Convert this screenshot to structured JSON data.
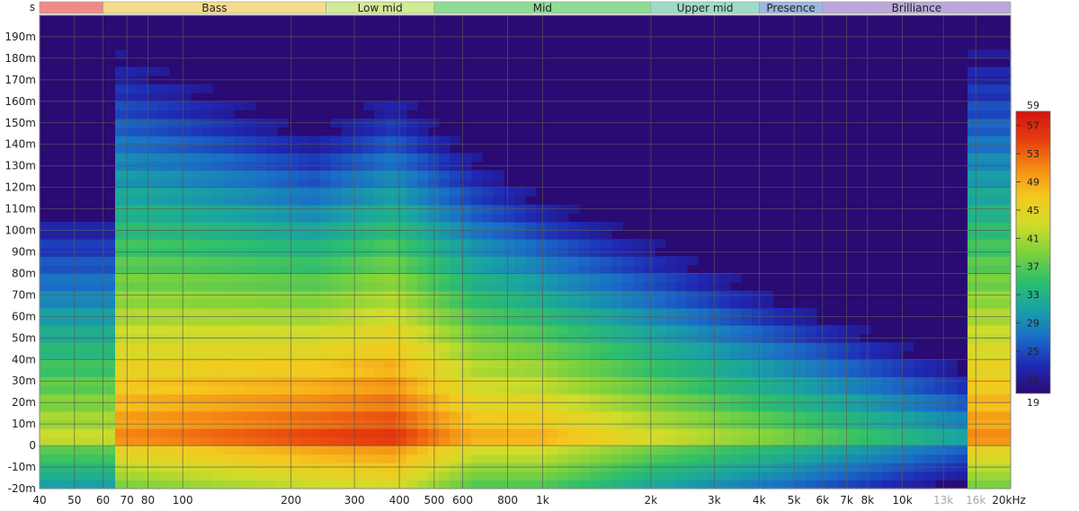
{
  "chart_data": {
    "type": "heatmap",
    "title": "",
    "ylabel": "s",
    "x_axis_unit": "kHz",
    "x_scale": "log",
    "xlim": [
      40,
      20000
    ],
    "ylim": [
      -0.02,
      0.2
    ],
    "x_tick_labels": [
      "40",
      "50",
      "60",
      "70",
      "80",
      "100",
      "200",
      "300",
      "400",
      "500",
      "600",
      "800",
      "1k",
      "2k",
      "3k",
      "4k",
      "5k",
      "6k",
      "7k",
      "8k",
      "10k",
      "13k",
      "16k",
      "20kHz"
    ],
    "x_tick_values": [
      40,
      50,
      60,
      70,
      80,
      100,
      200,
      300,
      400,
      500,
      600,
      800,
      1000,
      2000,
      3000,
      4000,
      5000,
      6000,
      7000,
      8000,
      10000,
      13000,
      16000,
      20000
    ],
    "x_tick_muted": [
      false,
      false,
      false,
      false,
      false,
      false,
      false,
      false,
      false,
      false,
      false,
      false,
      false,
      false,
      false,
      false,
      false,
      false,
      false,
      false,
      false,
      true,
      true,
      false
    ],
    "y_tick_labels": [
      "-20m",
      "-10m",
      "0",
      "10m",
      "20m",
      "30m",
      "40m",
      "50m",
      "60m",
      "70m",
      "80m",
      "90m",
      "100m",
      "110m",
      "120m",
      "130m",
      "140m",
      "150m",
      "160m",
      "170m",
      "180m",
      "190m"
    ],
    "y_tick_values": [
      -0.02,
      -0.01,
      0,
      0.01,
      0.02,
      0.03,
      0.04,
      0.05,
      0.06,
      0.07,
      0.08,
      0.09,
      0.1,
      0.11,
      0.12,
      0.13,
      0.14,
      0.15,
      0.16,
      0.17,
      0.18,
      0.19
    ],
    "grid": true,
    "colorbar": {
      "min": 19,
      "max": 59,
      "tick_labels": [
        "59",
        "57",
        "53",
        "49",
        "45",
        "41",
        "37",
        "33",
        "29",
        "25",
        "21",
        "19"
      ],
      "tick_values": [
        59,
        57,
        53,
        49,
        45,
        41,
        37,
        33,
        29,
        25,
        21,
        19
      ],
      "placement": "right",
      "colors": [
        "#2a0a73",
        "#1e2ab4",
        "#1a6ec8",
        "#19a3a3",
        "#2fbf6a",
        "#7ed23c",
        "#d2dc2a",
        "#f5c81e",
        "#f58a14",
        "#e63c0f",
        "#d21412"
      ]
    },
    "bands": [
      {
        "label": "",
        "start": 40,
        "end": 60,
        "color": "#f08a8a"
      },
      {
        "label": "Bass",
        "start": 60,
        "end": 250,
        "color": "#f5dc8c"
      },
      {
        "label": "Low mid",
        "start": 250,
        "end": 500,
        "color": "#d2ea96"
      },
      {
        "label": "Mid",
        "start": 500,
        "end": 2000,
        "color": "#8fdc96"
      },
      {
        "label": "Upper mid",
        "start": 2000,
        "end": 4000,
        "color": "#9edcc8"
      },
      {
        "label": "Presence",
        "start": 4000,
        "end": 6000,
        "color": "#9cb8e0"
      },
      {
        "label": "Brilliance",
        "start": 6000,
        "end": 20000,
        "color": "#b9a8d8"
      }
    ],
    "background_color": "#2a0a73",
    "features": [
      {
        "f": 65,
        "level": 52,
        "decay_s": 0.19
      },
      {
        "f": 230,
        "level": 56,
        "decay_s": 0.15
      },
      {
        "f": 385,
        "level": 57,
        "decay_s": 0.17
      },
      {
        "f": 650,
        "level": 50,
        "decay_s": 0.14
      },
      {
        "f": 1000,
        "level": 50,
        "decay_s": 0.12
      },
      {
        "f": 2000,
        "level": 45,
        "decay_s": 0.1
      },
      {
        "f": 5000,
        "level": 40,
        "decay_s": 0.07
      },
      {
        "f": 15000,
        "level": 33,
        "decay_s": 0.04
      }
    ]
  }
}
